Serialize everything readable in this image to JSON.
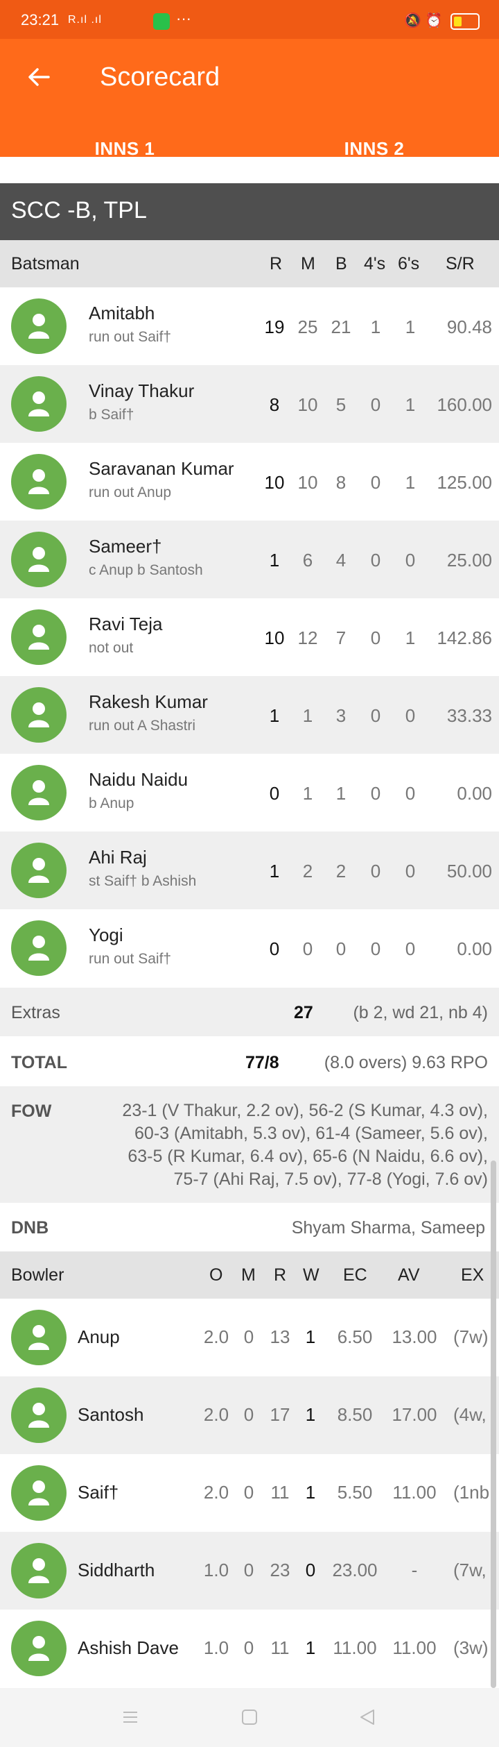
{
  "status": {
    "time": "23:21",
    "signal": "R.ıl .ıl",
    "dots": "···"
  },
  "header": {
    "title": "Scorecard",
    "tabs": [
      "INNS 1",
      "INNS 2"
    ],
    "active_tab": "INNS 2"
  },
  "team": "SCC -B, TPL",
  "batting_header": {
    "label": "Batsman",
    "cols": [
      "R",
      "M",
      "B",
      "4's",
      "6's",
      "S/R"
    ]
  },
  "batsmen": [
    {
      "name": "Amitabh",
      "dismissal": "run out Saif†",
      "r": "19",
      "m": "25",
      "b": "21",
      "fours": "1",
      "sixes": "1",
      "sr": "90.48"
    },
    {
      "name": "Vinay Thakur",
      "dismissal": "b Saif†",
      "r": "8",
      "m": "10",
      "b": "5",
      "fours": "0",
      "sixes": "1",
      "sr": "160.00"
    },
    {
      "name": "Saravanan Kumar",
      "dismissal": "run out Anup",
      "r": "10",
      "m": "10",
      "b": "8",
      "fours": "0",
      "sixes": "1",
      "sr": "125.00"
    },
    {
      "name": "Sameer†",
      "dismissal": "c Anup b Santosh",
      "r": "1",
      "m": "6",
      "b": "4",
      "fours": "0",
      "sixes": "0",
      "sr": "25.00"
    },
    {
      "name": "Ravi Teja",
      "dismissal": "not out",
      "r": "10",
      "m": "12",
      "b": "7",
      "fours": "0",
      "sixes": "1",
      "sr": "142.86"
    },
    {
      "name": "Rakesh Kumar",
      "dismissal": "run out A Shastri",
      "r": "1",
      "m": "1",
      "b": "3",
      "fours": "0",
      "sixes": "0",
      "sr": "33.33"
    },
    {
      "name": "Naidu Naidu",
      "dismissal": "b Anup",
      "r": "0",
      "m": "1",
      "b": "1",
      "fours": "0",
      "sixes": "0",
      "sr": "0.00"
    },
    {
      "name": "Ahi Raj",
      "dismissal": "st Saif† b Ashish",
      "r": "1",
      "m": "2",
      "b": "2",
      "fours": "0",
      "sixes": "0",
      "sr": "50.00"
    },
    {
      "name": "Yogi",
      "dismissal": "run out Saif†",
      "r": "0",
      "m": "0",
      "b": "0",
      "fours": "0",
      "sixes": "0",
      "sr": "0.00"
    }
  ],
  "extras": {
    "label": "Extras",
    "value": "27",
    "detail": "(b 2, wd 21, nb 4)"
  },
  "total": {
    "label": "TOTAL",
    "value": "77/8",
    "detail": "(8.0 overs) 9.63 RPO"
  },
  "fow": {
    "label": "FOW",
    "lines": [
      "23-1 (V Thakur, 2.2 ov), 56-2 (S Kumar, 4.3 ov),",
      "60-3 (Amitabh, 5.3 ov), 61-4 (Sameer, 5.6 ov),",
      "63-5 (R Kumar, 6.4 ov), 65-6 (N Naidu, 6.6 ov),",
      "75-7 (Ahi Raj, 7.5 ov), 77-8 (Yogi, 7.6 ov)"
    ]
  },
  "dnb": {
    "label": "DNB",
    "value": "Shyam Sharma, Sameep"
  },
  "bowling_header": {
    "label": "Bowler",
    "cols": [
      "O",
      "M",
      "R",
      "W",
      "EC",
      "AV",
      "EX"
    ]
  },
  "bowlers": [
    {
      "name": "Anup",
      "o": "2.0",
      "m": "0",
      "r": "13",
      "w": "1",
      "ec": "6.50",
      "av": "13.00",
      "ex": "(7w)"
    },
    {
      "name": "Santosh",
      "o": "2.0",
      "m": "0",
      "r": "17",
      "w": "1",
      "ec": "8.50",
      "av": "17.00",
      "ex": "(4w,"
    },
    {
      "name": "Saif†",
      "o": "2.0",
      "m": "0",
      "r": "11",
      "w": "1",
      "ec": "5.50",
      "av": "11.00",
      "ex": "(1nb"
    },
    {
      "name": "Siddharth",
      "o": "1.0",
      "m": "0",
      "r": "23",
      "w": "0",
      "ec": "23.00",
      "av": "-",
      "ex": "(7w,"
    },
    {
      "name": "Ashish Dave",
      "o": "1.0",
      "m": "0",
      "r": "11",
      "w": "1",
      "ec": "11.00",
      "av": "11.00",
      "ex": "(3w)"
    }
  ],
  "colors": {
    "appbar": "#ff6a1a",
    "statusbar": "#f05a14",
    "team_bar": "#4f4f4f",
    "avatar": "#6ab04c"
  }
}
